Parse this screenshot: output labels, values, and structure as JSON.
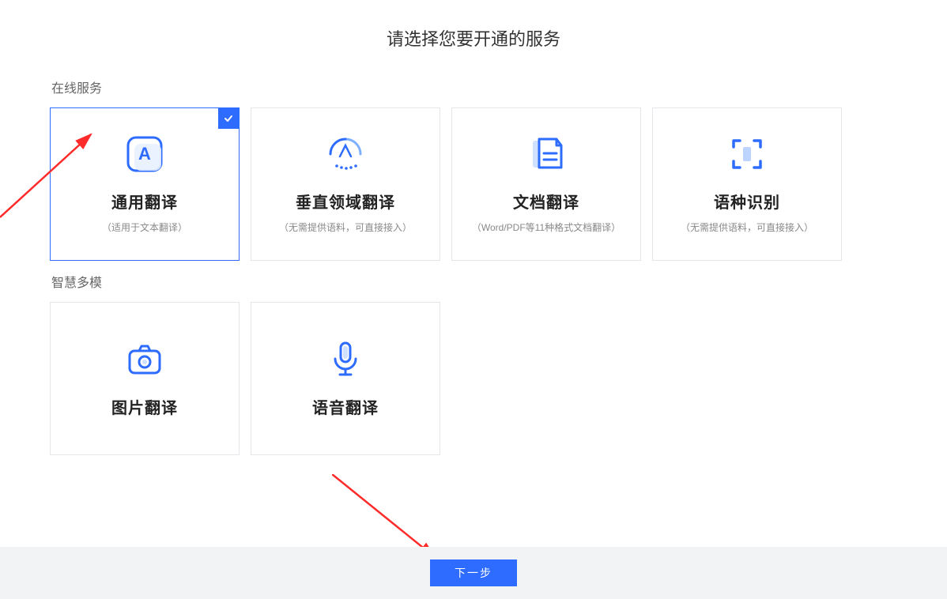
{
  "title": "请选择您要开通的服务",
  "sections": {
    "online": {
      "label": "在线服务",
      "cards": [
        {
          "title": "通用翻译",
          "sub": "（适用于文本翻译）"
        },
        {
          "title": "垂直领域翻译",
          "sub": "（无需提供语料，可直接接入）"
        },
        {
          "title": "文档翻译",
          "sub": "（Word/PDF等11种格式文档翻译）"
        },
        {
          "title": "语种识别",
          "sub": "（无需提供语料，可直接接入）"
        }
      ]
    },
    "multimodal": {
      "label": "智慧多模",
      "cards": [
        {
          "title": "图片翻译",
          "sub": ""
        },
        {
          "title": "语音翻译",
          "sub": ""
        }
      ]
    }
  },
  "button": {
    "next": "下一步"
  }
}
